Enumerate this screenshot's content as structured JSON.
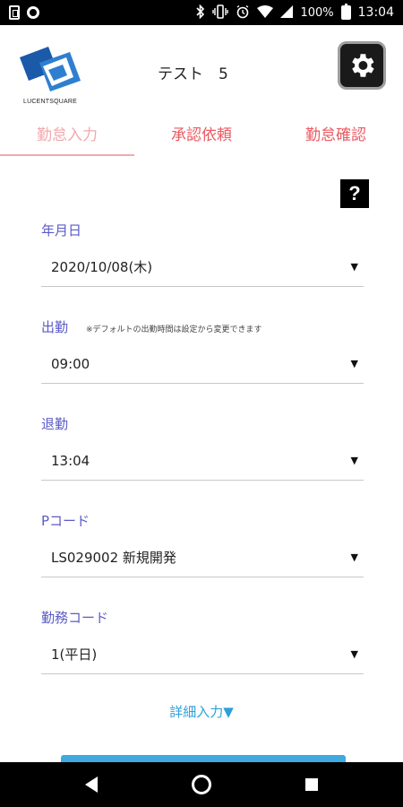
{
  "status_bar": {
    "battery": "100%",
    "time": "13:04",
    "left_icons": [
      "sim-icon",
      "circle-notification-icon"
    ],
    "right_icons": [
      "bluetooth-icon",
      "vibrate-icon",
      "alarm-icon",
      "wifi-icon",
      "signal-icon",
      "battery-icon"
    ]
  },
  "header": {
    "logo_text": "LUCENTSQUARE",
    "user_name": "テスト　5",
    "settings_icon": "gear-icon"
  },
  "tabs": [
    {
      "label": "勤怠入力",
      "active": true
    },
    {
      "label": "承認依頼",
      "active": false
    },
    {
      "label": "勤怠確認",
      "active": false
    }
  ],
  "help": {
    "label": "?"
  },
  "form": {
    "date": {
      "label": "年月日",
      "value": "2020/10/08(木)"
    },
    "start": {
      "label": "出勤",
      "note": "※デフォルトの出勤時間は設定から変更できます",
      "value": "09:00"
    },
    "end": {
      "label": "退勤",
      "value": "13:04"
    },
    "pcode": {
      "label": "Pコード",
      "value": "LS029002 新規開発"
    },
    "work_code": {
      "label": "勤務コード",
      "value": "1(平日)"
    }
  },
  "detail_link": "詳細入力▼",
  "colors": {
    "tab_text": "#ea5a62",
    "tab_active": "#f2a9ae",
    "field_label": "#5b5bc9",
    "link": "#2e9fd9",
    "submit": "#3fa9e0"
  },
  "nav": [
    "back-icon",
    "home-icon",
    "recents-icon"
  ]
}
